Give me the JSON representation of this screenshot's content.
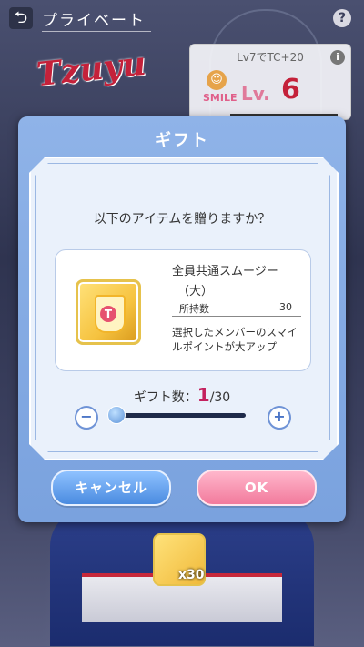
{
  "header": {
    "back_icon": "back-arrow-icon",
    "title": "プライベート",
    "help_label": "?"
  },
  "logo": {
    "text": "Tzuyu"
  },
  "level_panel": {
    "hint": "Lv7でTC+20",
    "info_label": "i",
    "smile_label": "SMILE",
    "lv_label": "Lv.",
    "lv_value": "6"
  },
  "dialog": {
    "title": "ギフト",
    "question": "以下のアイテムを贈りますか？",
    "item": {
      "name": "全員共通スムージー",
      "size": "（大）",
      "owned_label": "所持数",
      "owned_value": "30",
      "description": "選択したメンバーのスマイルポイントが大アップ",
      "icon": "smoothie-icon"
    },
    "gift_count": {
      "label": "ギフト数：",
      "value": "1",
      "max": "/30",
      "slider_fraction": 0.0
    },
    "cancel_label": "キャンセル",
    "ok_label": "OK"
  },
  "reward": {
    "count": "x30"
  },
  "colors": {
    "accent_pink": "#c4215e",
    "dialog_blue": "#8fb3e8",
    "ok_pink": "#f27a9c",
    "cancel_blue": "#4a8be0"
  }
}
